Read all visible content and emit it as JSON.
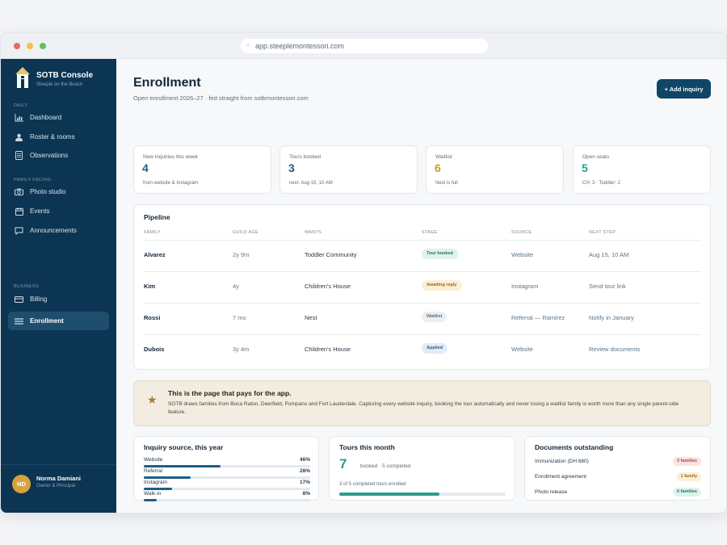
{
  "browser": {
    "url": "app.steeplemontessori.com"
  },
  "brand": {
    "title": "SOTB Console",
    "subtitle": "Steeple on the Beach"
  },
  "sidebar": {
    "sections": [
      "Daily",
      "Family-facing",
      "Business"
    ],
    "items": [
      {
        "label": "Dashboard",
        "icon": "chart-icon"
      },
      {
        "label": "Roster & rooms",
        "icon": "person-icon"
      },
      {
        "label": "Observations",
        "icon": "document-icon"
      },
      {
        "label": "Photo studio",
        "icon": "camera-icon"
      },
      {
        "label": "Events",
        "icon": "calendar-icon"
      },
      {
        "label": "Announcements",
        "icon": "chat-icon"
      },
      {
        "label": "Billing",
        "icon": "card-icon"
      },
      {
        "label": "Enrollment",
        "icon": "list-icon"
      }
    ],
    "active": "Enrollment"
  },
  "user": {
    "initials": "ND",
    "name": "Norma Damiani",
    "role": "Owner & Principal"
  },
  "header": {
    "title": "Enrollment",
    "subtitle": "Open enrollment 2026–27  ·  fed straight from sotbmontessori.com",
    "add_button": "+ Add inquiry"
  },
  "stats": [
    {
      "label": "New inquiries this week",
      "value": "4",
      "note": "from website & Instagram",
      "color": "#1c5f8a"
    },
    {
      "label": "Tours booked",
      "value": "3",
      "note": "next: Aug 15, 10 AM",
      "color": "#1c5f8a"
    },
    {
      "label": "Waitlist",
      "value": "6",
      "note": "Nest is full",
      "color": "#c99a2e"
    },
    {
      "label": "Open seats",
      "value": "5",
      "note": "CH: 3 · Toddler: 2",
      "color": "#2a9d8f"
    }
  ],
  "pipeline": {
    "title": "Pipeline",
    "columns": [
      "Family",
      "Child age",
      "Wants",
      "Stage",
      "Source",
      "Next step"
    ],
    "rows": [
      {
        "family": "Alvarez",
        "age": "2y 9m",
        "wants": "Toddler Community",
        "stage": "Tour booked",
        "stage_kind": "green",
        "source": "Website",
        "next": "Aug 15, 10 AM"
      },
      {
        "family": "Kim",
        "age": "4y",
        "wants": "Children's House",
        "stage": "Awaiting reply",
        "stage_kind": "amber",
        "source": "Instagram",
        "next": "Send tour link"
      },
      {
        "family": "Rossi",
        "age": "7 mo",
        "wants": "Nest",
        "stage": "Waitlist",
        "stage_kind": "gray",
        "source": "Referral — Ramirez",
        "next": "Notify in January"
      },
      {
        "family": "Dubois",
        "age": "3y 4m",
        "wants": "Children's House",
        "stage": "Applied",
        "stage_kind": "blue",
        "source": "Website",
        "next": "Review documents"
      }
    ]
  },
  "banner": {
    "title": "This is the page that pays for the app.",
    "body": "SOTB draws families from Boca Raton, Deerfield, Pompano and Fort Lauderdale. Capturing every website inquiry, booking the tour automatically and never losing a waitlist family is worth more than any single parent-side feature."
  },
  "inquiry_source": {
    "title": "Inquiry source, this year",
    "items": [
      {
        "label": "Website",
        "value": "46%",
        "fraction": 0.46
      },
      {
        "label": "Referral",
        "value": "28%",
        "fraction": 0.28
      },
      {
        "label": "Instagram",
        "value": "17%",
        "fraction": 0.17
      },
      {
        "label": "Walk-in",
        "value": "8%",
        "fraction": 0.08
      }
    ]
  },
  "tours": {
    "title": "Tours this month",
    "value": "7",
    "desc": "booked · 5 completed",
    "note": "3 of 5 completed tours enrolled",
    "fraction": 0.6
  },
  "documents": {
    "title": "Documents outstanding",
    "items": [
      {
        "label": "Immunization (DH 680)",
        "badge": "3 families",
        "kind": "red"
      },
      {
        "label": "Enrollment agreement",
        "badge": "1 family",
        "kind": "amber"
      },
      {
        "label": "Photo release",
        "badge": "0 families",
        "kind": "green"
      }
    ]
  }
}
